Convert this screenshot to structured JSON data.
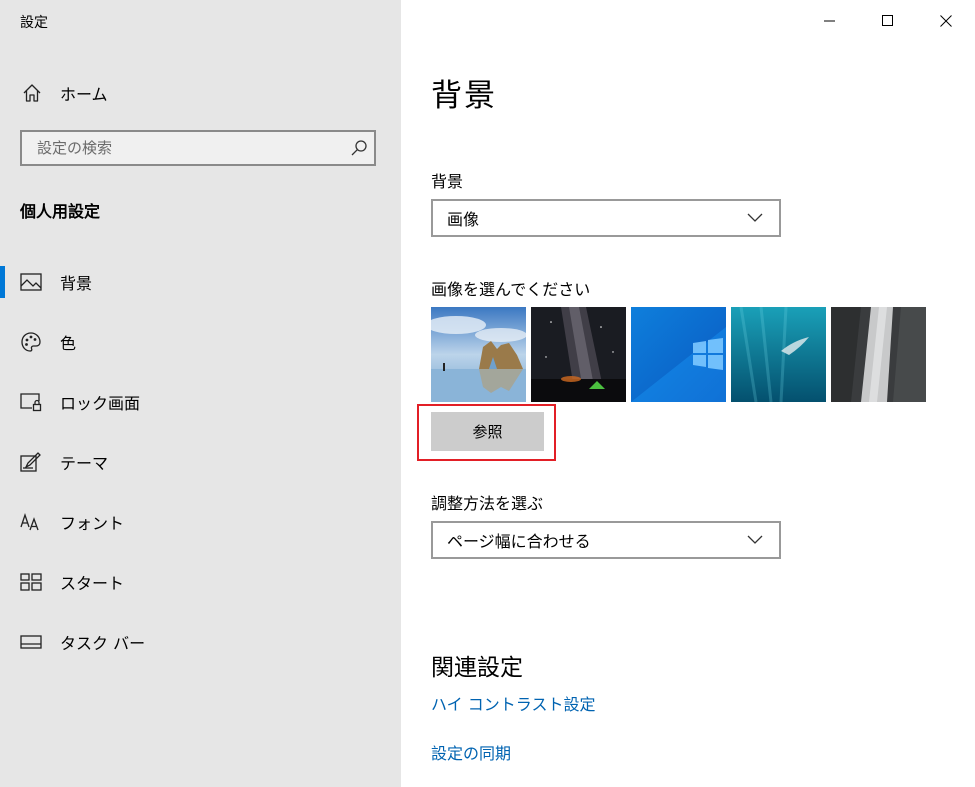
{
  "window": {
    "title": "設定",
    "minimize_icon": "minimize-icon",
    "maximize_icon": "maximize-icon",
    "close_icon": "close-icon"
  },
  "sidebar": {
    "home": {
      "label": "ホーム",
      "icon": "home-icon"
    },
    "search": {
      "placeholder": "設定の検索",
      "value": "",
      "icon": "search-icon"
    },
    "section_title": "個人用設定",
    "items": [
      {
        "label": "背景",
        "icon": "image-icon",
        "selected": true
      },
      {
        "label": "色",
        "icon": "palette-icon",
        "selected": false
      },
      {
        "label": "ロック画面",
        "icon": "lock-screen-icon",
        "selected": false
      },
      {
        "label": "テーマ",
        "icon": "theme-icon",
        "selected": false
      },
      {
        "label": "フォント",
        "icon": "font-icon",
        "selected": false
      },
      {
        "label": "スタート",
        "icon": "start-icon",
        "selected": false
      },
      {
        "label": "タスク バー",
        "icon": "taskbar-icon",
        "selected": false
      }
    ],
    "accent_color": "#0078d7"
  },
  "main": {
    "title": "背景",
    "background": {
      "label": "背景",
      "value": "画像"
    },
    "choose_label": "画像を選んでください",
    "thumbnails": [
      "sea-arch-thumbnail",
      "milky-way-thumbnail",
      "windows-logo-thumbnail",
      "underwater-swimmer-thumbnail",
      "cliff-thumbnail"
    ],
    "browse_label": "参照",
    "fit": {
      "label": "調整方法を選ぶ",
      "value": "ページ幅に合わせる"
    },
    "related": {
      "title": "関連設定",
      "links": [
        "ハイ コントラスト設定",
        "設定の同期"
      ]
    },
    "link_color": "#0063b1",
    "highlight_color": "#e21f26"
  }
}
